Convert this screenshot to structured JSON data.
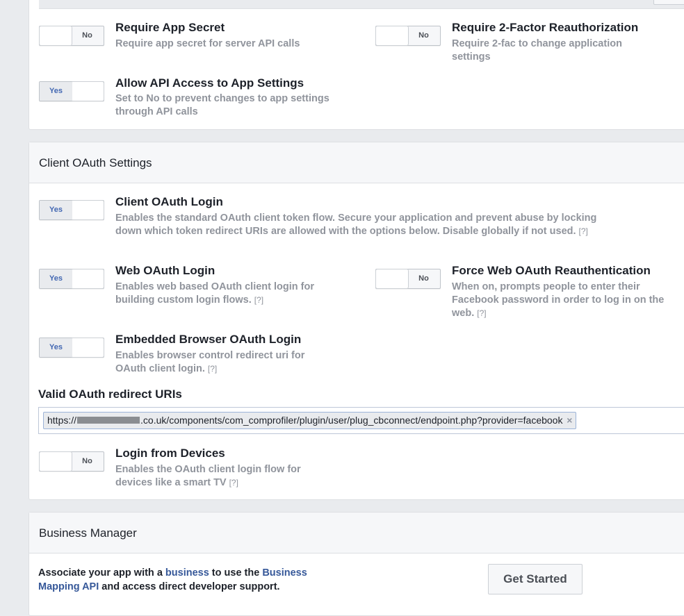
{
  "advanced": {
    "require_app_secret": {
      "toggle": "No",
      "title": "Require App Secret",
      "desc": "Require app secret for server API calls"
    },
    "require_2fa": {
      "toggle": "No",
      "title": "Require 2-Factor Reauthorization",
      "desc": "Require 2-fac to change application settings"
    },
    "allow_api_access": {
      "toggle": "Yes",
      "title": "Allow API Access to App Settings",
      "desc": "Set to No to prevent changes to app settings through API calls"
    }
  },
  "client_oauth": {
    "section_title": "Client OAuth Settings",
    "help": "[?]",
    "client_login": {
      "toggle": "Yes",
      "title": "Client OAuth Login",
      "desc": "Enables the standard OAuth client token flow. Secure your application and prevent abuse by locking down which token redirect URIs are allowed with the options below. Disable globally if not used."
    },
    "web_login": {
      "toggle": "Yes",
      "title": "Web OAuth Login",
      "desc": "Enables web based OAuth client login for building custom login flows."
    },
    "force_reauth": {
      "toggle": "No",
      "title": "Force Web OAuth Reauthentication",
      "desc": "When on, prompts people to enter their Facebook password in order to log in on the web."
    },
    "embedded_browser": {
      "toggle": "Yes",
      "title": "Embedded Browser OAuth Login",
      "desc": "Enables browser control redirect uri for OAuth client login."
    },
    "redirect_label": "Valid OAuth redirect URIs",
    "redirect_uri_prefix": "https://",
    "redirect_uri_suffix": ".co.uk/components/com_comprofiler/plugin/user/plug_cbconnect/endpoint.php?provider=facebook",
    "remove_symbol": "×",
    "devices": {
      "toggle": "No",
      "title": "Login from Devices",
      "desc": "Enables the OAuth client login flow for devices like a smart TV"
    }
  },
  "business_manager": {
    "section_title": "Business Manager",
    "text_1": "Associate your app with a ",
    "link_business": "business",
    "text_2": " to use the ",
    "link_mapping": "Business Mapping API",
    "text_3": " and access direct developer support.",
    "button": "Get Started"
  },
  "colors": {
    "link": "#365899",
    "yes_text": "#4267b2",
    "desc_text": "#90949c"
  }
}
